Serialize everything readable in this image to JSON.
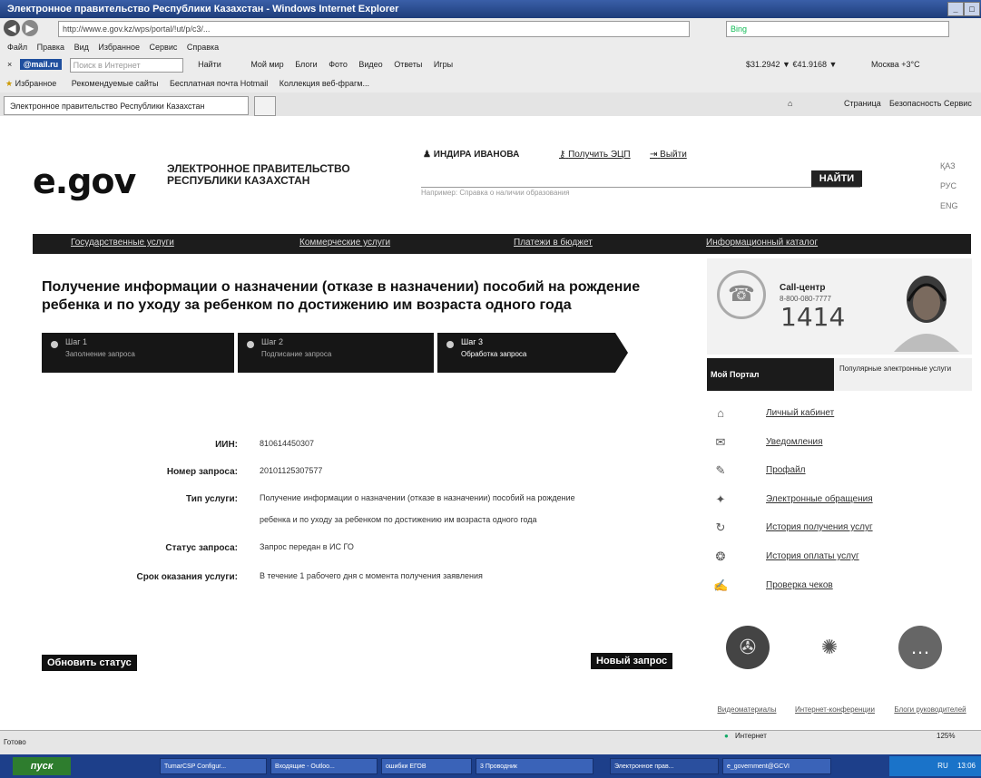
{
  "window": {
    "title": "Электронное правительство Республики Казахстан - Windows Internet Explorer"
  },
  "browser": {
    "url": "http://www.e.gov.kz/wps/portal/!ut/p/c3/...",
    "menu": [
      "Файл",
      "Правка",
      "Вид",
      "Избранное",
      "Сервис",
      "Справка"
    ],
    "mail_logo": "@mail.ru",
    "mail_search_placeholder": "Поиск в Интернет",
    "mail_links": [
      "Найти",
      "Мой мир",
      "Блоги",
      "Фото",
      "Видео",
      "Ответы",
      "Игры"
    ],
    "rates": "$31.2942 ▼  €41.9168 ▼",
    "weather": "Москва +3°С",
    "fav_label": "Избранное",
    "fav_links": [
      "Рекомендуемые сайты",
      "Бесплатная почта Hotmail",
      "Коллекция веб-фрагм..."
    ],
    "tab_title": "Электронное правительство Республики Казахстан",
    "tools": [
      "Страница",
      "Безопасность",
      "Сервис"
    ],
    "status_left": "Готово",
    "status_zone": "Интернет",
    "zoom": "125%"
  },
  "header": {
    "logo": "e.gov",
    "logo_line1": "ЭЛЕКТРОННОЕ ПРАВИТЕЛЬСТВО",
    "logo_line2": "РЕСПУБЛИКИ КАЗАХСТАН",
    "user": "ИНДИРА ИВАНОВА",
    "get_signature": "Получить ЭЦП",
    "logout": "Выйти",
    "search_value": "",
    "search_button": "НАЙТИ",
    "search_hint": "Например: Справка о наличии образования",
    "languages": [
      "ҚАЗ",
      "РУС",
      "ENG"
    ]
  },
  "nav": [
    "Государственные услуги",
    "Коммерческие услуги",
    "Платежи в бюджет",
    "Информационный каталог"
  ],
  "main": {
    "heading": "Получение информации о назначении (отказе в назначении) пособий на рождение ребенка и по уходу за ребенком по достижению им возраста одного года",
    "steps": [
      {
        "num": "Шаг 1",
        "desc": "Заполнение запроса"
      },
      {
        "num": "Шаг 2",
        "desc": "Подписание запроса"
      },
      {
        "num": "Шаг 3",
        "desc": "Обработка запроса"
      }
    ],
    "fields": [
      {
        "label": "ИИН:",
        "value": "810614450307"
      },
      {
        "label": "Номер запроса:",
        "value": "20101125307577"
      },
      {
        "label": "Тип услуги:",
        "value": "Получение информации о назначении (отказе в назначении) пособий на рождение",
        "value2": "ребенка и по уходу за ребенком по достижению им возраста одного года"
      },
      {
        "label": "Статус запроса:",
        "value": "Запрос передан в ИС ГО"
      },
      {
        "label": "Срок оказания услуги:",
        "value": "В течение 1 рабочего дня с момента получения заявления"
      }
    ],
    "refresh_button": "Обновить статус",
    "new_request_button": "Новый запрос"
  },
  "sidebar": {
    "call_label": "Call-центр",
    "call_phone": "8-800-080-7777",
    "call_short": "1414",
    "tab_my": "Мой Портал",
    "tab_popular": "Популярные электронные услуги",
    "items": [
      "Личный кабинет",
      "Уведомления",
      "Профайл",
      "Электронные обращения",
      "История получения услуг",
      "История оплаты услуг",
      "Проверка чеков"
    ],
    "media": [
      "Видеоматериалы",
      "Интернет-конференции",
      "Блоги руководителей"
    ]
  },
  "taskbar": {
    "start": "пуск",
    "items": [
      "TumarCSP Configur...",
      "Входящие - Outloo...",
      "ошибки ЕГОВ",
      "3 Проводник",
      "Электронное прав...",
      "e_government@GCVI"
    ],
    "lang": "RU",
    "clock": "13:06"
  }
}
